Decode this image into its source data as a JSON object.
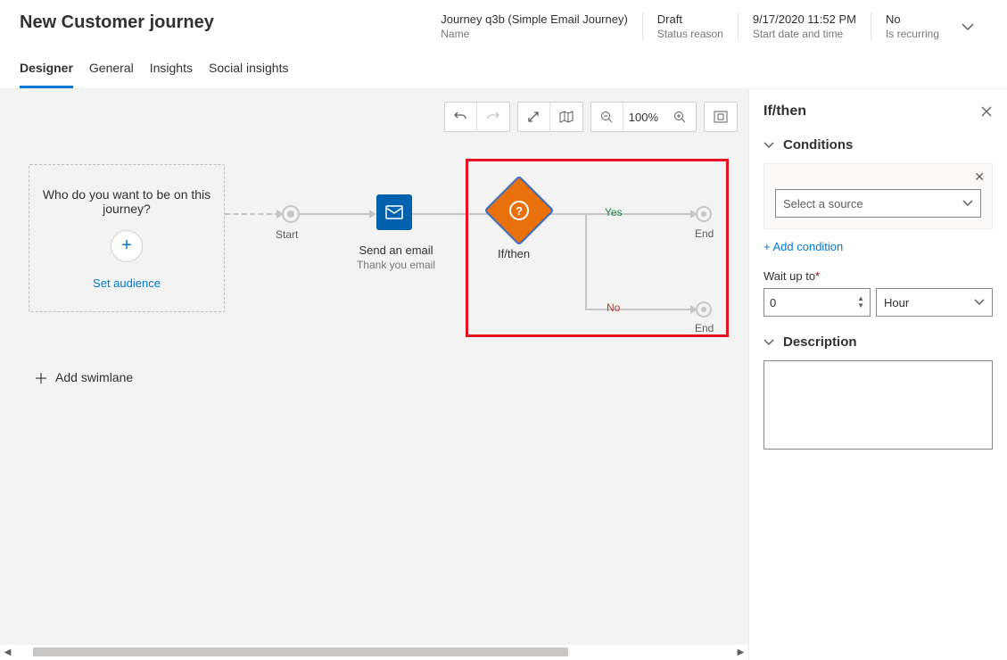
{
  "page_title": "New Customer journey",
  "meta": {
    "name_value": "Journey q3b (Simple Email Journey)",
    "name_label": "Name",
    "status_value": "Draft",
    "status_label": "Status reason",
    "date_value": "9/17/2020 11:52 PM",
    "date_label": "Start date and time",
    "recurring_value": "No",
    "recurring_label": "Is recurring"
  },
  "tabs": {
    "designer": "Designer",
    "general": "General",
    "insights": "Insights",
    "social": "Social insights"
  },
  "toolbar": {
    "zoom": "100%"
  },
  "canvas": {
    "audience_question": "Who do you want to be on this journey?",
    "set_audience": "Set audience",
    "start": "Start",
    "email_title": "Send an email",
    "email_sub": "Thank you email",
    "ifthen": "If/then",
    "yes": "Yes",
    "no": "No",
    "end": "End",
    "add_swimlane": "Add swimlane"
  },
  "panel": {
    "title": "If/then",
    "conditions": "Conditions",
    "select_source_placeholder": "Select a source",
    "add_condition": "+ Add condition",
    "wait_up_to": "Wait up to",
    "wait_value": "0",
    "wait_unit": "Hour",
    "description": "Description",
    "description_value": ""
  }
}
